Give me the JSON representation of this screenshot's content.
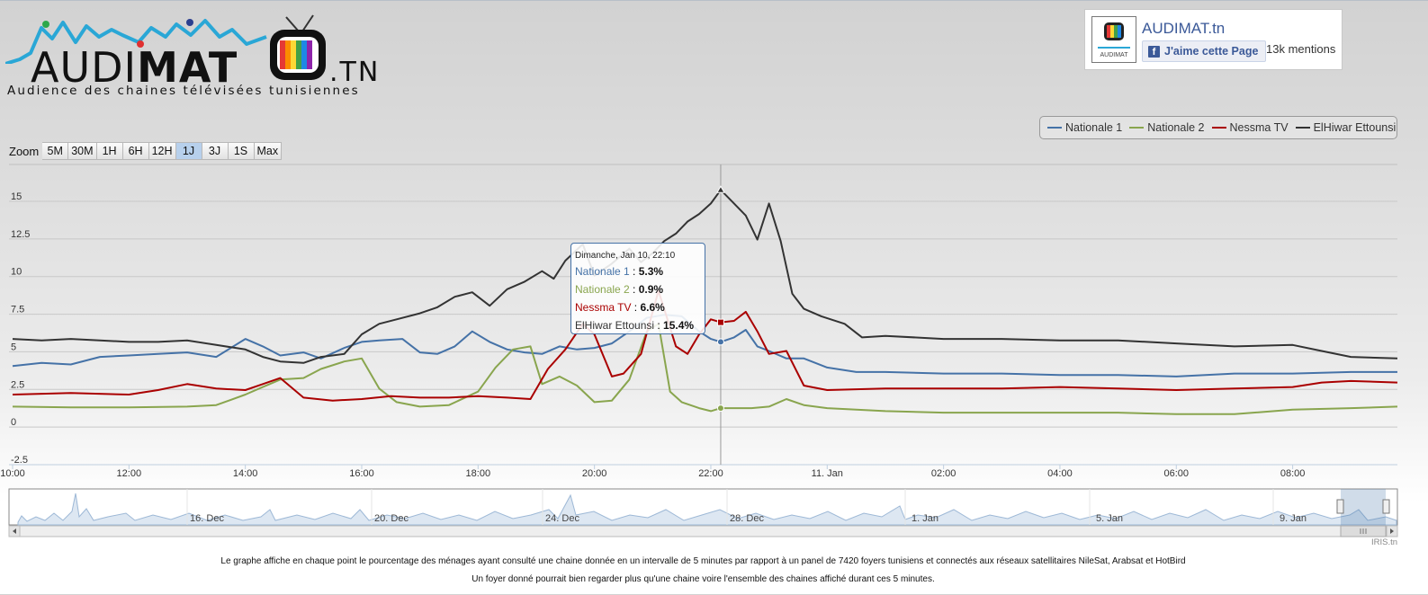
{
  "logo": {
    "word_left": "AUDI",
    "word_bold": "MAT",
    "suffix": ".TN",
    "tagline": "Audience des chaines télévisées tunisiennes"
  },
  "facebook": {
    "title": "AUDIMAT.tn",
    "like_label": "J'aime cette Page",
    "mentions": "13k mentions",
    "icon": "facebook-f-icon",
    "brand_color": "#3b5998"
  },
  "zoom": {
    "label": "Zoom",
    "buttons": [
      "5M",
      "30M",
      "1H",
      "6H",
      "12H",
      "1J",
      "3J",
      "1S",
      "Max"
    ],
    "selected": "1J"
  },
  "legend": {
    "items": [
      {
        "label": "Nationale 1",
        "color": "#4572A7"
      },
      {
        "label": "Nationale 2",
        "color": "#89A54E"
      },
      {
        "label": "Nessma TV",
        "color": "#AA0000"
      },
      {
        "label": "ElHiwar Ettounsi",
        "color": "#333333"
      }
    ]
  },
  "tooltip": {
    "header": "Dimanche, Jan 10, 22:10",
    "rows": [
      {
        "label": "Nationale 1",
        "value": "5.3%",
        "color": "#4572A7"
      },
      {
        "label": "Nationale 2",
        "value": "0.9%",
        "color": "#89A54E"
      },
      {
        "label": "Nessma TV",
        "value": "6.6%",
        "color": "#AA0000"
      },
      {
        "label": "ElHiwar Ettounsi",
        "value": "15.4%",
        "color": "#333333"
      }
    ]
  },
  "chart_data": {
    "type": "line",
    "y_ticks": [
      "15",
      "12.5",
      "10",
      "7.5",
      "5",
      "2.5",
      "0",
      "-2.5"
    ],
    "y_tick_values": [
      15,
      12.5,
      10,
      7.5,
      5,
      2.5,
      0,
      -2.5
    ],
    "ylim": [
      -2.5,
      15
    ],
    "x_tick_labels": [
      "10:00",
      "12:00",
      "14:00",
      "16:00",
      "18:00",
      "20:00",
      "22:00",
      "11. Jan",
      "02:00",
      "04:00",
      "06:00",
      "08:00"
    ],
    "x_tick_hours": [
      10,
      12,
      14,
      16,
      18,
      20,
      22,
      24,
      26,
      28,
      30,
      32
    ],
    "xlim_hours": [
      10,
      33.8
    ],
    "crosshair_hour": 22.17,
    "series": [
      {
        "name": "Nationale 1",
        "color": "#4572A7",
        "points": [
          [
            10,
            3.7
          ],
          [
            10.5,
            3.9
          ],
          [
            11,
            3.8
          ],
          [
            11.5,
            4.3
          ],
          [
            12,
            4.4
          ],
          [
            12.5,
            4.5
          ],
          [
            13,
            4.6
          ],
          [
            13.5,
            4.3
          ],
          [
            14,
            5.5
          ],
          [
            14.3,
            5.0
          ],
          [
            14.6,
            4.4
          ],
          [
            15,
            4.6
          ],
          [
            15.3,
            4.2
          ],
          [
            15.7,
            4.9
          ],
          [
            16,
            5.3
          ],
          [
            16.3,
            5.4
          ],
          [
            16.7,
            5.5
          ],
          [
            17,
            4.6
          ],
          [
            17.3,
            4.5
          ],
          [
            17.6,
            5.0
          ],
          [
            17.9,
            6.0
          ],
          [
            18.2,
            5.3
          ],
          [
            18.5,
            4.8
          ],
          [
            18.8,
            4.6
          ],
          [
            19.1,
            4.5
          ],
          [
            19.4,
            5.0
          ],
          [
            19.7,
            4.8
          ],
          [
            20,
            4.9
          ],
          [
            20.3,
            5.2
          ],
          [
            20.6,
            6.0
          ],
          [
            20.9,
            6.9
          ],
          [
            21.2,
            7.1
          ],
          [
            21.5,
            7.0
          ],
          [
            21.8,
            6.0
          ],
          [
            22.0,
            5.5
          ],
          [
            22.17,
            5.3
          ],
          [
            22.4,
            5.6
          ],
          [
            22.6,
            6.1
          ],
          [
            22.8,
            5.0
          ],
          [
            23.0,
            4.7
          ],
          [
            23.3,
            4.2
          ],
          [
            23.6,
            4.2
          ],
          [
            24,
            3.6
          ],
          [
            24.5,
            3.3
          ],
          [
            25,
            3.3
          ],
          [
            26,
            3.2
          ],
          [
            27,
            3.2
          ],
          [
            28,
            3.1
          ],
          [
            29,
            3.1
          ],
          [
            30,
            3.0
          ],
          [
            31,
            3.2
          ],
          [
            32,
            3.2
          ],
          [
            33,
            3.3
          ],
          [
            33.8,
            3.3
          ]
        ]
      },
      {
        "name": "Nationale 2",
        "color": "#89A54E",
        "points": [
          [
            10,
            1.0
          ],
          [
            11,
            0.95
          ],
          [
            12,
            0.95
          ],
          [
            13,
            1.0
          ],
          [
            13.5,
            1.1
          ],
          [
            14,
            1.8
          ],
          [
            14.3,
            2.3
          ],
          [
            14.6,
            2.8
          ],
          [
            15,
            2.9
          ],
          [
            15.3,
            3.5
          ],
          [
            15.7,
            4.0
          ],
          [
            16,
            4.2
          ],
          [
            16.3,
            2.2
          ],
          [
            16.6,
            1.3
          ],
          [
            17,
            1.0
          ],
          [
            17.5,
            1.1
          ],
          [
            18,
            2.0
          ],
          [
            18.3,
            3.6
          ],
          [
            18.6,
            4.8
          ],
          [
            18.9,
            5.0
          ],
          [
            19.1,
            2.5
          ],
          [
            19.4,
            3.0
          ],
          [
            19.7,
            2.4
          ],
          [
            20,
            1.3
          ],
          [
            20.3,
            1.4
          ],
          [
            20.6,
            2.8
          ],
          [
            20.9,
            6.0
          ],
          [
            21.1,
            6.5
          ],
          [
            21.3,
            2.0
          ],
          [
            21.5,
            1.3
          ],
          [
            21.8,
            0.9
          ],
          [
            22.0,
            0.7
          ],
          [
            22.17,
            0.9
          ],
          [
            22.4,
            0.9
          ],
          [
            22.7,
            0.9
          ],
          [
            23.0,
            1.0
          ],
          [
            23.3,
            1.5
          ],
          [
            23.6,
            1.1
          ],
          [
            24,
            0.9
          ],
          [
            25,
            0.7
          ],
          [
            26,
            0.6
          ],
          [
            27,
            0.6
          ],
          [
            28,
            0.6
          ],
          [
            29,
            0.6
          ],
          [
            30,
            0.5
          ],
          [
            31,
            0.5
          ],
          [
            32,
            0.8
          ],
          [
            33,
            0.9
          ],
          [
            33.8,
            1.0
          ]
        ]
      },
      {
        "name": "Nessma TV",
        "color": "#AA0000",
        "points": [
          [
            10,
            1.8
          ],
          [
            11,
            1.9
          ],
          [
            12,
            1.8
          ],
          [
            12.5,
            2.1
          ],
          [
            13,
            2.5
          ],
          [
            13.5,
            2.2
          ],
          [
            14,
            2.1
          ],
          [
            14.3,
            2.5
          ],
          [
            14.6,
            2.9
          ],
          [
            15,
            1.6
          ],
          [
            15.5,
            1.4
          ],
          [
            16,
            1.5
          ],
          [
            16.5,
            1.7
          ],
          [
            17,
            1.6
          ],
          [
            17.5,
            1.6
          ],
          [
            18,
            1.7
          ],
          [
            18.5,
            1.6
          ],
          [
            18.9,
            1.5
          ],
          [
            19.2,
            3.5
          ],
          [
            19.5,
            4.8
          ],
          [
            19.8,
            6.5
          ],
          [
            20,
            5.8
          ],
          [
            20.3,
            3.0
          ],
          [
            20.5,
            3.2
          ],
          [
            20.8,
            4.5
          ],
          [
            21.1,
            8.7
          ],
          [
            21.4,
            5.0
          ],
          [
            21.6,
            4.5
          ],
          [
            21.8,
            5.8
          ],
          [
            22.0,
            6.8
          ],
          [
            22.17,
            6.6
          ],
          [
            22.4,
            6.7
          ],
          [
            22.6,
            7.3
          ],
          [
            22.8,
            6.0
          ],
          [
            23.0,
            4.5
          ],
          [
            23.3,
            4.7
          ],
          [
            23.6,
            2.4
          ],
          [
            24,
            2.1
          ],
          [
            25,
            2.2
          ],
          [
            26,
            2.2
          ],
          [
            27,
            2.2
          ],
          [
            28,
            2.3
          ],
          [
            29,
            2.2
          ],
          [
            30,
            2.1
          ],
          [
            31,
            2.2
          ],
          [
            32,
            2.3
          ],
          [
            32.5,
            2.6
          ],
          [
            33,
            2.7
          ],
          [
            33.8,
            2.6
          ]
        ]
      },
      {
        "name": "ElHiwar Ettounsi",
        "color": "#333333",
        "points": [
          [
            10,
            5.5
          ],
          [
            10.5,
            5.4
          ],
          [
            11,
            5.5
          ],
          [
            11.5,
            5.4
          ],
          [
            12,
            5.3
          ],
          [
            12.5,
            5.3
          ],
          [
            13,
            5.4
          ],
          [
            13.5,
            5.1
          ],
          [
            14,
            4.8
          ],
          [
            14.3,
            4.3
          ],
          [
            14.6,
            4.0
          ],
          [
            15,
            3.9
          ],
          [
            15.3,
            4.3
          ],
          [
            15.7,
            4.5
          ],
          [
            16,
            5.8
          ],
          [
            16.3,
            6.5
          ],
          [
            16.6,
            6.8
          ],
          [
            17,
            7.2
          ],
          [
            17.3,
            7.6
          ],
          [
            17.6,
            8.3
          ],
          [
            17.9,
            8.6
          ],
          [
            18.2,
            7.7
          ],
          [
            18.5,
            8.8
          ],
          [
            18.8,
            9.3
          ],
          [
            19.1,
            10.0
          ],
          [
            19.3,
            9.5
          ],
          [
            19.5,
            10.7
          ],
          [
            19.8,
            11.8
          ],
          [
            20.0,
            9.7
          ],
          [
            20.3,
            10.5
          ],
          [
            20.6,
            11.5
          ],
          [
            20.8,
            10.6
          ],
          [
            21.0,
            11.2
          ],
          [
            21.2,
            12.0
          ],
          [
            21.4,
            12.5
          ],
          [
            21.6,
            13.3
          ],
          [
            21.8,
            13.8
          ],
          [
            22.0,
            14.5
          ],
          [
            22.17,
            15.4
          ],
          [
            22.4,
            14.5
          ],
          [
            22.6,
            13.7
          ],
          [
            22.8,
            12.1
          ],
          [
            23.0,
            14.5
          ],
          [
            23.2,
            12.0
          ],
          [
            23.4,
            8.5
          ],
          [
            23.6,
            7.5
          ],
          [
            23.9,
            7.0
          ],
          [
            24.3,
            6.5
          ],
          [
            24.6,
            5.6
          ],
          [
            25,
            5.7
          ],
          [
            26,
            5.5
          ],
          [
            27,
            5.5
          ],
          [
            28,
            5.4
          ],
          [
            29,
            5.4
          ],
          [
            30,
            5.2
          ],
          [
            31,
            5.0
          ],
          [
            32,
            5.1
          ],
          [
            32.5,
            4.7
          ],
          [
            33,
            4.3
          ],
          [
            33.8,
            4.2
          ]
        ]
      }
    ],
    "navigator_labels": [
      "16. Dec",
      "20. Dec",
      "24. Dec",
      "28. Dec",
      "1. Jan",
      "5. Jan",
      "9. Jan"
    ]
  },
  "footer": {
    "line1": "Le graphe affiche en chaque point le pourcentage des ménages ayant consulté une chaine donnée en un intervalle de 5 minutes par rapport à un panel de 7420 foyers tunisiens et connectés aux réseaux satellitaires NileSat, Arabsat et HotBird",
    "line2": "Un foyer donné pourrait bien regarder plus qu'une chaine voire l'ensemble des chaines affiché durant ces 5 minutes.",
    "credit": "IRIS.tn"
  }
}
